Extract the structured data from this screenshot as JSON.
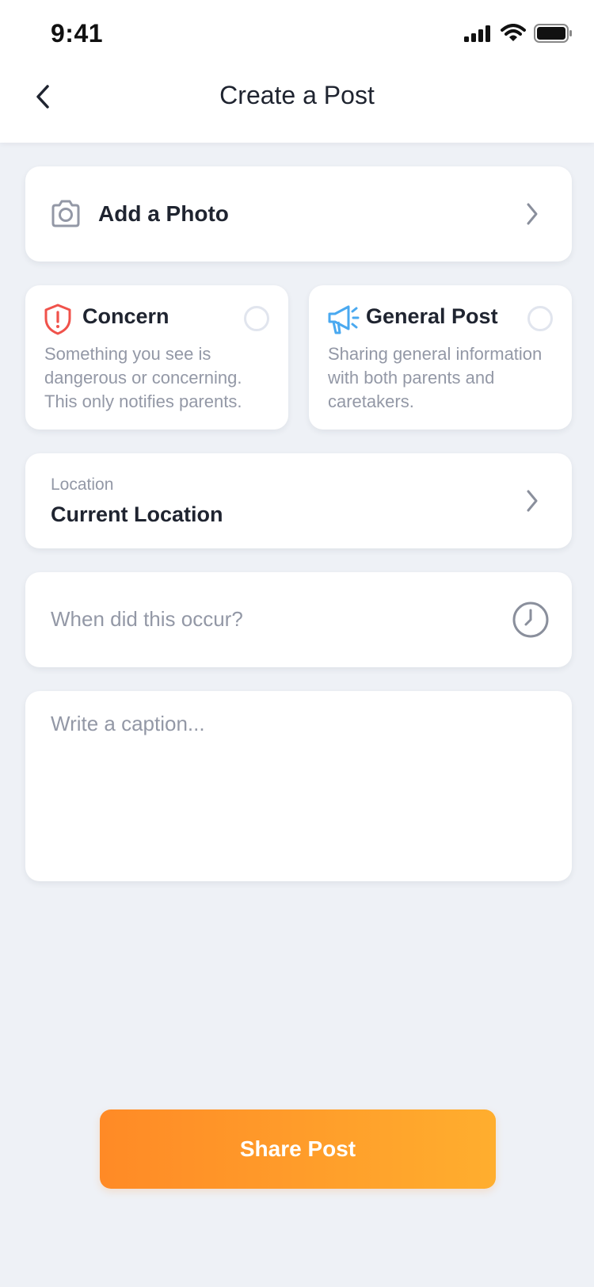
{
  "status_bar": {
    "time": "9:41"
  },
  "header": {
    "title": "Create a Post"
  },
  "photo": {
    "label": "Add a Photo"
  },
  "post_types": [
    {
      "title": "Concern",
      "description": "Something you see is dangerous or concerning. This only notifies parents.",
      "icon": "shield-alert-icon",
      "color": "#F0524B"
    },
    {
      "title": "General Post",
      "description": "Sharing general information with both parents and caretakers.",
      "icon": "megaphone-icon",
      "color": "#4AA9F0"
    }
  ],
  "location": {
    "label": "Location",
    "value": "Current Location"
  },
  "time": {
    "placeholder": "When did this occur?"
  },
  "caption": {
    "placeholder": "Write a caption..."
  },
  "share_button": {
    "label": "Share Post"
  },
  "colors": {
    "accent_start": "#FF8A26",
    "accent_end": "#FFAE2E",
    "background": "#EEF1F6"
  }
}
